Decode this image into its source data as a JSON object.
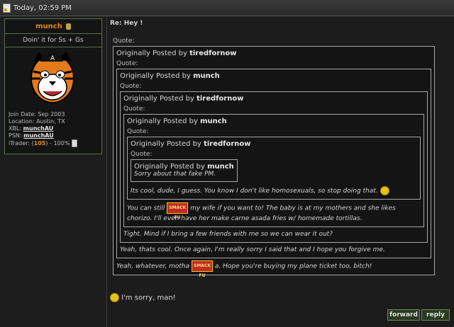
{
  "topbar": {
    "timestamp": "Today, 02:59 PM",
    "icon": "document-icon"
  },
  "user": {
    "name": "munch",
    "title": "Doin' it for Ss + Gs",
    "avatar": "tiger-mascot",
    "join_date_label": "Join Date: Sep 2003",
    "location_label": "Location: Austin, TX",
    "xbl_label": "XBL:",
    "xbl_value": "munchAU",
    "psn_label": "PSN:",
    "psn_value": "munchAU",
    "itrader_label": "iTrader:",
    "itrader_open": "(",
    "itrader_count": "105",
    "itrader_close": ")",
    "itrader_percent": "- 100%"
  },
  "post": {
    "subject": "Re: Hey !",
    "quote_label": "Quote:",
    "posted_by": "Originally Posted by",
    "q1_author": "tiredfornow",
    "q2_author": "munch",
    "q3_author": "tiredfornow",
    "q4_author": "munch",
    "q5_author": "tiredfornow",
    "q6_author": "munch",
    "q6_text": "Sorry about that fake PM.",
    "q5_text": "Its cool, dude, I guess. You know I don't like homosexuals, so stop doing that.",
    "q4_text_a": "You can still",
    "q4_text_b": "my wife if you want to! The baby is at my mothers and she likes chorizo. I'll even have her make carne asada fries w/ homemade tortillas.",
    "q3_text": "Tight. Mind if I bring a few friends with me so we can wear it out?",
    "q2_text": "Yeah, thats cool. Once again, I'm really sorry I said that and I hope you forgive me.",
    "q1_text_a": "Yeah, whatever, motha",
    "q1_text_b": "a. Hope you're buying my plane ticket too, bitch!",
    "smilie_label": "SMACK FU",
    "reply_text": "I'm sorry, man!"
  },
  "buttons": {
    "forward": "forward",
    "reply": "reply"
  }
}
